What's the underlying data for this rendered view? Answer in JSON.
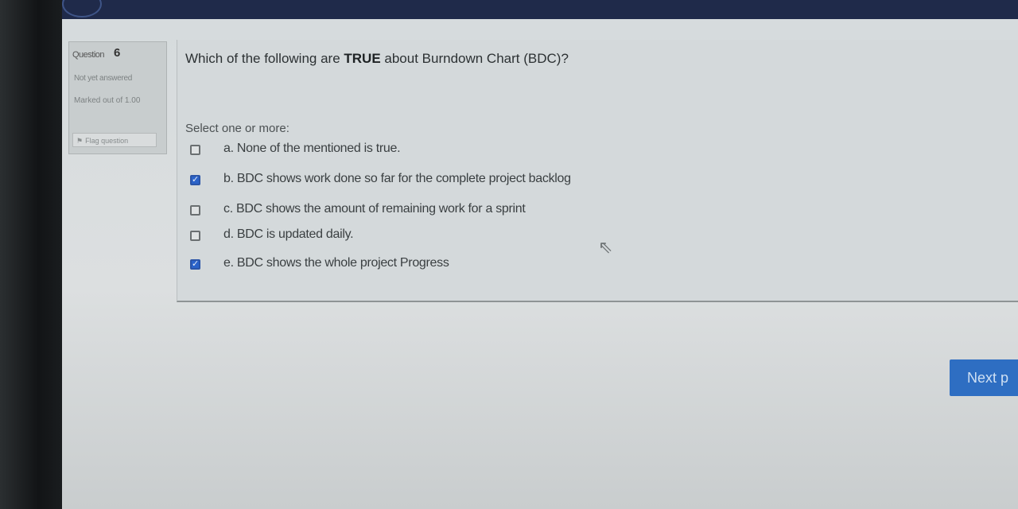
{
  "question_info": {
    "label": "Question",
    "number": "6",
    "state": "Not yet answered",
    "marked": "Marked out of 1.00",
    "flag_label": "Flag question"
  },
  "question": {
    "text_before": "Which of the following are ",
    "text_emphasis": "TRUE",
    "text_after": " about Burndown Chart (BDC)?",
    "prompt": "Select one or more:",
    "options": [
      {
        "label": "a. None of the mentioned is true.",
        "checked": false
      },
      {
        "label": "b. BDC shows work done so far for the complete project backlog",
        "checked": true
      },
      {
        "label": "c. BDC shows the amount of remaining work for a sprint",
        "checked": false
      },
      {
        "label": "d. BDC is updated daily.",
        "checked": false
      },
      {
        "label": "e. BDC shows the whole project Progress",
        "checked": true
      }
    ]
  },
  "nav": {
    "next_label": "Next p"
  },
  "colors": {
    "accent": "#2e6ec2",
    "checkbox_checked": "#2b63c9",
    "topbar": "#1f2a4a",
    "topbar_stripe": "#d24a38"
  },
  "icons": {
    "flag": "flag-icon",
    "cursor": "mouse-pointer-icon"
  }
}
